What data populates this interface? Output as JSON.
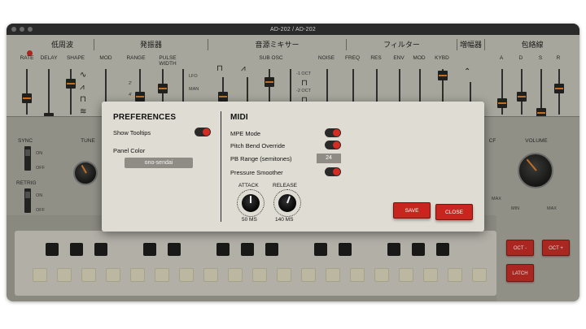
{
  "window": {
    "title": "AD-202 / AD-202"
  },
  "sections": {
    "lfo": "低周波",
    "vco": "発振器",
    "mixer": "音源ミキサー",
    "filter": "フィルター",
    "amp": "増幅器",
    "env": "包絡線"
  },
  "labels": {
    "rate": "RATE",
    "delay": "DELAY",
    "shape": "SHAPE",
    "mod": "MOD",
    "range": "RANGE",
    "pulse_width": "PULSE WIDTH",
    "sub_osc": "SUB OSC",
    "noise": "NOISE",
    "freq": "FREQ",
    "res": "RES",
    "env": "ENV",
    "fmod": "MOD",
    "kybd": "KYBD",
    "a": "A",
    "d": "D",
    "s": "S",
    "r": "R",
    "lfo_small": "LFO",
    "man_small": "MAN",
    "oct1": "-1 OCT",
    "oct2": "-2 OCT",
    "r2": "2'",
    "r4": "4'",
    "sync": "SYNC",
    "on": "ON",
    "off": "OFF",
    "retrig": "RETRIG",
    "on2": "ON",
    "off2": "OFF",
    "tune": "TUNE",
    "cf": "CF",
    "volume": "VOLUME",
    "max": "MAX",
    "min": "MIN",
    "max2": "MAX"
  },
  "controls": {
    "oct_minus": "OCT -",
    "oct_plus": "OCT +",
    "latch": "LATCH"
  },
  "preferences": {
    "heading": "PREFERENCES",
    "show_tooltips": "Show Tooltips",
    "panel_color_label": "Panel Color",
    "panel_color_value": "ono-sendai"
  },
  "midi": {
    "heading": "MIDI",
    "mpe_mode": "MPE Mode",
    "pitch_bend_override": "Pitch Bend Override",
    "pb_range_label": "PB Range (semitones)",
    "pb_range_value": "24",
    "pressure_smoother": "Pressure Smoother",
    "attack_label": "ATTACK",
    "attack_value": "50 MS",
    "release_label": "RELEASE",
    "release_value": "140 MS"
  },
  "buttons": {
    "save": "SAVE",
    "close": "CLOSE"
  },
  "colors": {
    "accent_red": "#c7251e",
    "slider_orange": "#e07a22",
    "panel": "#bfbdb3"
  }
}
